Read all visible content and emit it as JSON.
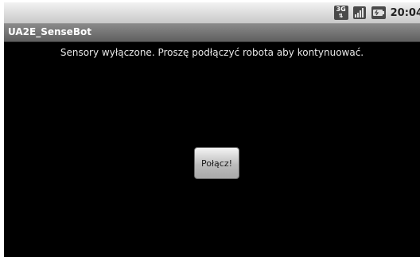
{
  "status_bar": {
    "network_label": "3G",
    "time": "20:04",
    "icons": [
      "network-3g-icon",
      "signal-strength-icon",
      "battery-icon"
    ]
  },
  "app": {
    "title": "UA2E_SenseBot"
  },
  "content": {
    "message": "Sensory wyłączone.  Proszę podłączyć robota aby kontynuować.",
    "connect_label": "Połącz!"
  },
  "colors": {
    "background": "#000000",
    "status_bar": "#d9d9d9",
    "title_bar": "#757575",
    "text": "#e8e8e8"
  }
}
